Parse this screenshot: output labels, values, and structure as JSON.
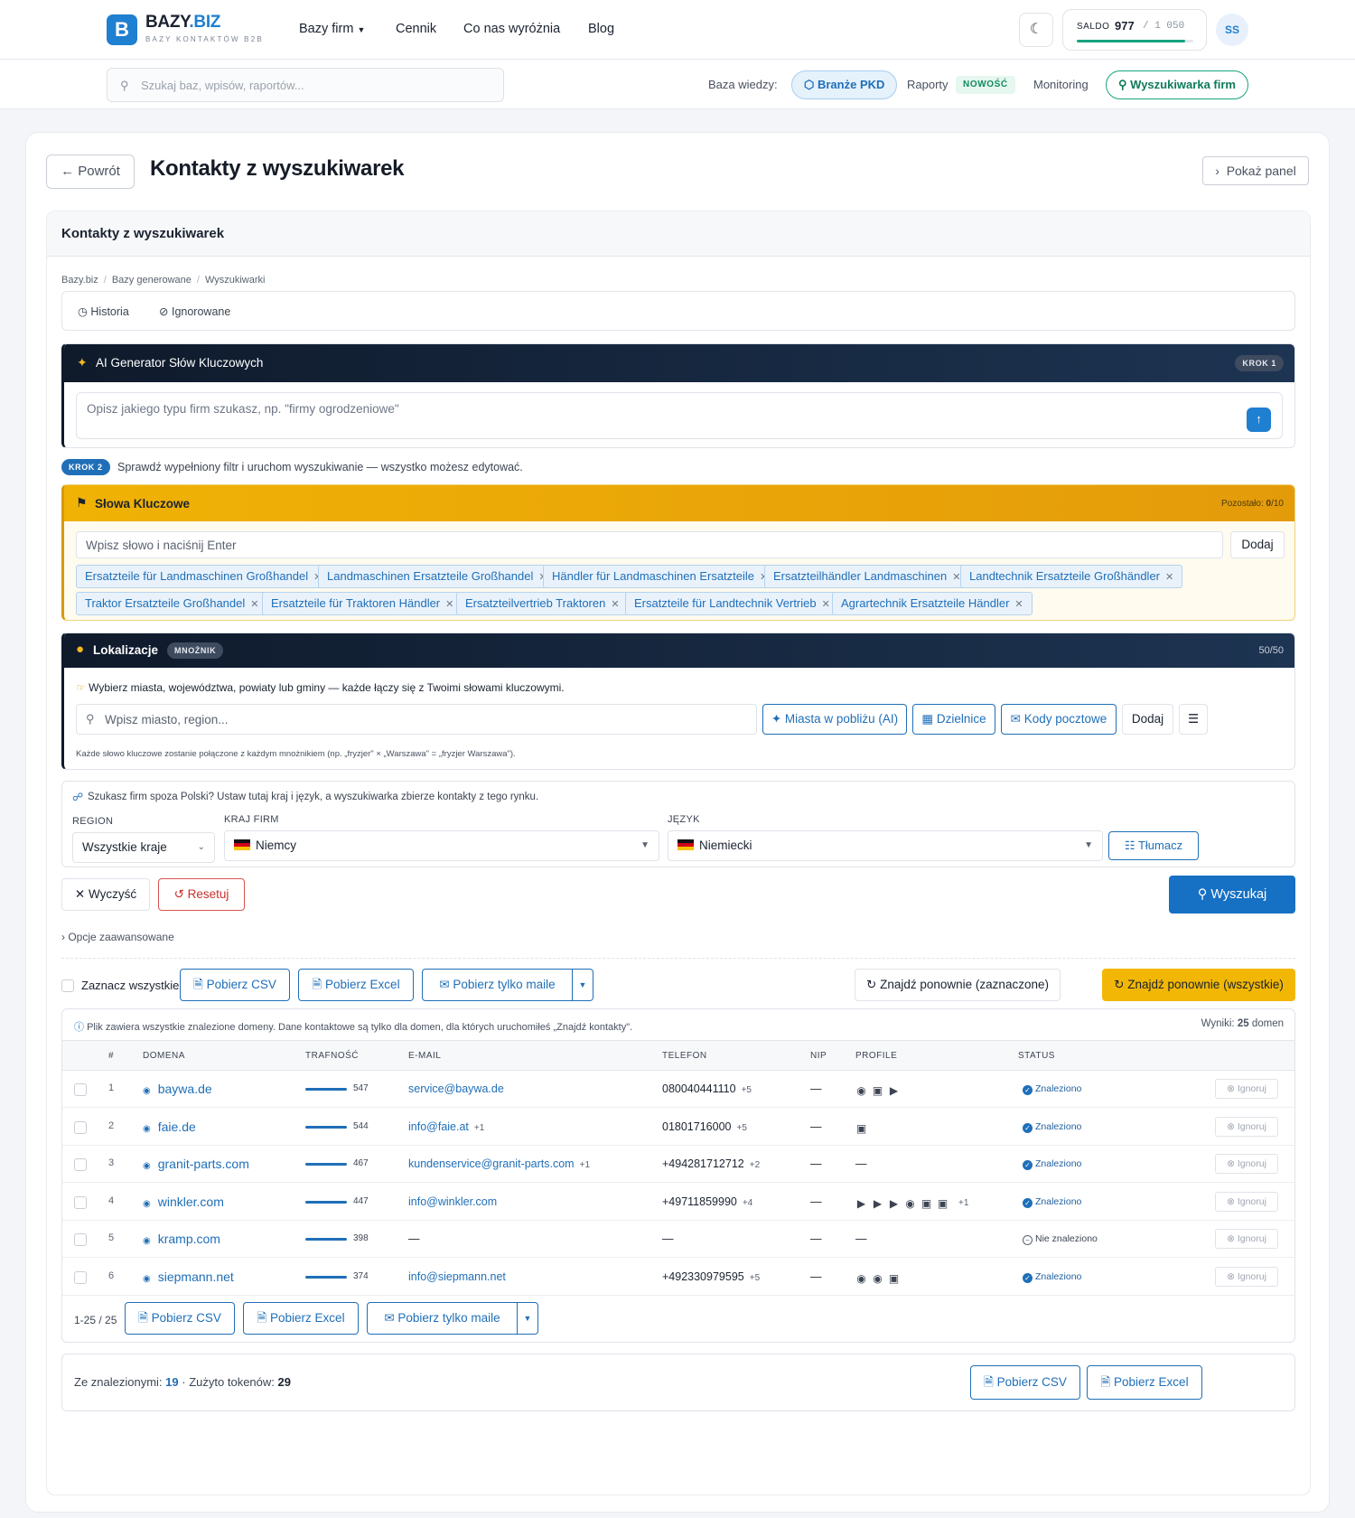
{
  "brand": {
    "logo_letter": "B",
    "name_a": "BAZY",
    "name_b": ".BIZ",
    "subtitle": "BAZY KONTAKTÓW B2B"
  },
  "nav": {
    "items": [
      "Bazy firm",
      "Cennik",
      "Co nas wyróżnia",
      "Blog"
    ]
  },
  "saldo": {
    "label": "SALDO",
    "value": "977",
    "total": "/ 1 050",
    "fraction": 0.93
  },
  "user": {
    "initials": "SS"
  },
  "search": {
    "placeholder": "Szukaj baz, wpisów, raportów..."
  },
  "knowledge": {
    "label": "Baza wiedzy:",
    "pkd": "Branże PKD",
    "raporty": "Raporty",
    "new_badge": "NOWOŚĆ",
    "monitoring": "Monitoring",
    "finder": "Wyszukiwarka firm"
  },
  "page": {
    "back": "Powrót",
    "title": "Kontakty z wyszukiwarek",
    "show_panel": "Pokaż panel",
    "section_title": "Kontakty z wyszukiwarek"
  },
  "breadcrumb": [
    "Bazy.biz",
    "Bazy generowane",
    "Wyszukiwarki"
  ],
  "tabs": {
    "history": "Historia",
    "ignored": "Ignorowane"
  },
  "ai": {
    "title": "AI Generator Słów Kluczowych",
    "step": "KROK 1",
    "placeholder": "Opisz jakiego typu firm szukasz, np. \"firmy ogrodzeniowe\""
  },
  "step2": {
    "badge": "KROK 2",
    "text": "Sprawdź wypełniony filtr i uruchom wyszukiwanie — wszystko możesz edytować."
  },
  "keywords": {
    "title": "Słowa Kluczowe",
    "remaining_label": "Pozostało:",
    "remaining_value": "0",
    "remaining_max": "/10",
    "placeholder": "Wpisz słowo i naciśnij Enter",
    "add": "Dodaj",
    "chips": [
      "Ersatzteile für Landmaschinen Großhandel",
      "Landmaschinen Ersatzteile Großhandel",
      "Händler für Landmaschinen Ersatzteile",
      "Ersatzteilhändler Landmaschinen",
      "Landtechnik Ersatzteile Großhändler",
      "Traktor Ersatzteile Großhandel",
      "Ersatzteile für Traktoren Händler",
      "Ersatzteilvertrieb Traktoren",
      "Ersatzteile für Landtechnik Vertrieb",
      "Agrartechnik Ersatzteile Händler"
    ]
  },
  "locations": {
    "title": "Lokalizacje",
    "badge": "MNOŻNIK",
    "count": "50/50",
    "info": "Wybierz miasta, województwa, powiaty lub gminy — każde łączy się z Twoimi słowami kluczowymi.",
    "placeholder": "Wpisz miasto, region...",
    "nearby": "Miasta w pobliżu (AI)",
    "districts": "Dzielnice",
    "postal": "Kody pocztowe",
    "add": "Dodaj",
    "note": "Każde słowo kluczowe zostanie połączone z każdym mnożnikiem (np. „fryzjer\" × „Warszawa\" = „fryzjer Warszawa\")."
  },
  "country": {
    "info": "Szukasz firm spoza Polski? Ustaw tutaj kraj i język, a wyszukiwarka zbierze kontakty z tego rynku.",
    "region_label": "REGION",
    "region_value": "Wszystkie kraje",
    "country_label": "KRAJ FIRM",
    "country_value": "Niemcy",
    "lang_label": "JĘZYK",
    "lang_value": "Niemiecki",
    "translate": "Tłumacz"
  },
  "actions": {
    "clear": "Wyczyść",
    "reset": "Resetuj",
    "search": "Wyszukaj",
    "advanced": "Opcje zaawansowane"
  },
  "bulk": {
    "select_all": "Zaznacz wszystkie",
    "csv": "Pobierz CSV",
    "excel": "Pobierz Excel",
    "mails": "Pobierz tylko maile",
    "refind_selected": "Znajdź ponownie (zaznaczone)",
    "refind_all": "Znajdź ponownie (wszystkie)"
  },
  "table": {
    "info": "Plik zawiera wszystkie znalezione domeny. Dane kontaktowe są tylko dla domen, dla których uruchomiłeś „Znajdź kontakty\".",
    "results_label": "Wyniki:",
    "results_value": "25",
    "results_unit": "domen",
    "columns": [
      "#",
      "DOMENA",
      "TRAFNOŚĆ",
      "E-MAIL",
      "TELEFON",
      "NIP",
      "PROFILE",
      "STATUS"
    ],
    "ignore": "Ignoruj",
    "rows": [
      {
        "n": "1",
        "domain": "baywa.de",
        "rel": "547",
        "email": "service@baywa.de",
        "email_more": "",
        "phone": "080040441110",
        "phone_more": "+5",
        "nip": "—",
        "profiles": [
          "facebook-icon",
          "instagram-icon",
          "youtube-icon"
        ],
        "profiles_more": "",
        "status": "Znaleziono",
        "found": true
      },
      {
        "n": "2",
        "domain": "faie.de",
        "rel": "544",
        "email": "info@faie.at",
        "email_more": "+1",
        "phone": "01801716000",
        "phone_more": "+5",
        "nip": "—",
        "profiles": [
          "instagram-icon"
        ],
        "profiles_more": "",
        "status": "Znaleziono",
        "found": true
      },
      {
        "n": "3",
        "domain": "granit-parts.com",
        "rel": "467",
        "email": "kundenservice@granit-parts.com",
        "email_more": "+1",
        "phone": "+494281712712",
        "phone_more": "+2",
        "nip": "—",
        "profiles": [],
        "profiles_more": "—",
        "status": "Znaleziono",
        "found": true
      },
      {
        "n": "4",
        "domain": "winkler.com",
        "rel": "447",
        "email": "info@winkler.com",
        "email_more": "",
        "phone": "+49711859990",
        "phone_more": "+4",
        "nip": "—",
        "profiles": [
          "youtube-icon",
          "youtube-icon",
          "youtube-icon",
          "facebook-icon",
          "instagram-icon",
          "instagram-icon"
        ],
        "profiles_more": "+1",
        "status": "Znaleziono",
        "found": true
      },
      {
        "n": "5",
        "domain": "kramp.com",
        "rel": "398",
        "email": "—",
        "email_more": "",
        "phone": "—",
        "phone_more": "",
        "nip": "—",
        "profiles": [],
        "profiles_more": "—",
        "status": "Nie znaleziono",
        "found": false
      },
      {
        "n": "6",
        "domain": "siepmann.net",
        "rel": "374",
        "email": "info@siepmann.net",
        "email_more": "",
        "phone": "+492330979595",
        "phone_more": "+5",
        "nip": "—",
        "profiles": [
          "facebook-icon",
          "facebook-icon",
          "instagram-icon"
        ],
        "profiles_more": "",
        "status": "Znaleziono",
        "found": true
      }
    ],
    "pager": "1-25 / 25"
  },
  "footer": {
    "found_label": "Ze znalezionymi:",
    "found_value": "19",
    "sep": "·",
    "tokens_label": "Zużyto tokenów:",
    "tokens_value": "29",
    "csv": "Pobierz CSV",
    "excel": "Pobierz Excel"
  }
}
